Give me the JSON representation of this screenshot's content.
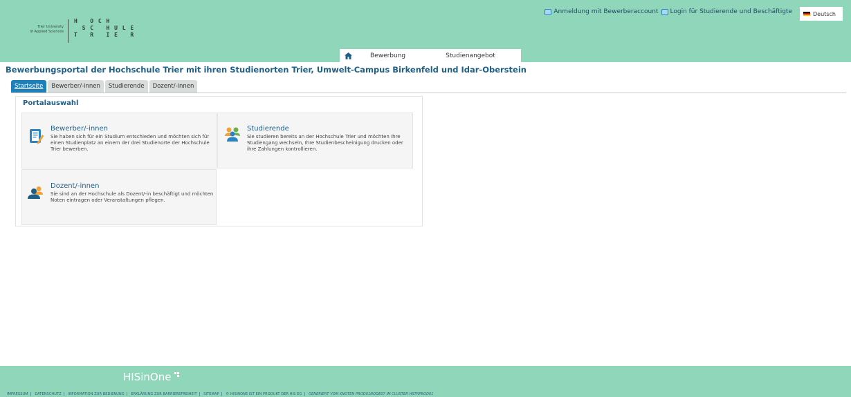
{
  "header": {
    "logo": {
      "line1": "Trier University",
      "line2": "of Applied Sciences",
      "wordmark": "H   O C H\n  S C   H U L E\nT   R   I E   R"
    },
    "links": [
      {
        "label": "Anmeldung mit Bewerberaccount",
        "icon": "login-icon"
      },
      {
        "label": "Login für Studierende und Beschäftigte",
        "icon": "login-icon"
      }
    ],
    "language": {
      "label": "Deutsch",
      "icon": "german-flag-icon"
    },
    "nav": {
      "home_icon": "home-icon",
      "items": [
        "Bewerbung",
        "Studienangebot"
      ]
    }
  },
  "page": {
    "title": "Bewerbungsportal der Hochschule Trier mit ihren Studienorten Trier, Umwelt-Campus Birkenfeld und Idar-Oberstein"
  },
  "tabs": [
    {
      "label": "Startseite",
      "active": true
    },
    {
      "label": "Bewerber/-innen",
      "active": false
    },
    {
      "label": "Studierende",
      "active": false
    },
    {
      "label": "Dozent/-innen",
      "active": false
    }
  ],
  "portal": {
    "title": "Portalauswahl",
    "cards": [
      {
        "title": "Bewerber/-innen",
        "text": "Sie haben sich für ein Studium entschieden und möchten sich für einen Studienplatz an einem der drei Studienorte der Hochschule Trier bewerben.",
        "icon": "application-form-icon"
      },
      {
        "title": "Studierende",
        "text": "Sie studieren bereits an der Hochschule Trier und möchten Ihre Studiengang wechseln, Ihre Studienbescheinigung drucken oder ihre Zahlungen kontrollieren.",
        "icon": "students-group-icon"
      },
      {
        "title": "Dozent/-innen",
        "text": "Sie sind an der Hochschule als Dozent/-in beschäftigt und möchten Noten eintragen oder Veranstaltungen pflegen.",
        "icon": "lecturers-icon"
      }
    ]
  },
  "footer": {
    "brand": "HISinOne",
    "links": [
      "IMPRESSUM",
      "DATENSCHUTZ",
      "INFORMATION ZUR BEDIENUNG",
      "ERKLÄRUNG ZUR BARRIEREFREIHEIT",
      "SITEMAP",
      "© HISINONE IST EIN PRODUKT DER HIS EG"
    ],
    "node_info": "GENERIERT VOM KNOTEN PROD01NODE07 IM CLUSTER HSTRPROD01"
  },
  "colors": {
    "header_bg": "#8fd6bb",
    "accent": "#1f7fb8",
    "title": "#1f5f86"
  }
}
